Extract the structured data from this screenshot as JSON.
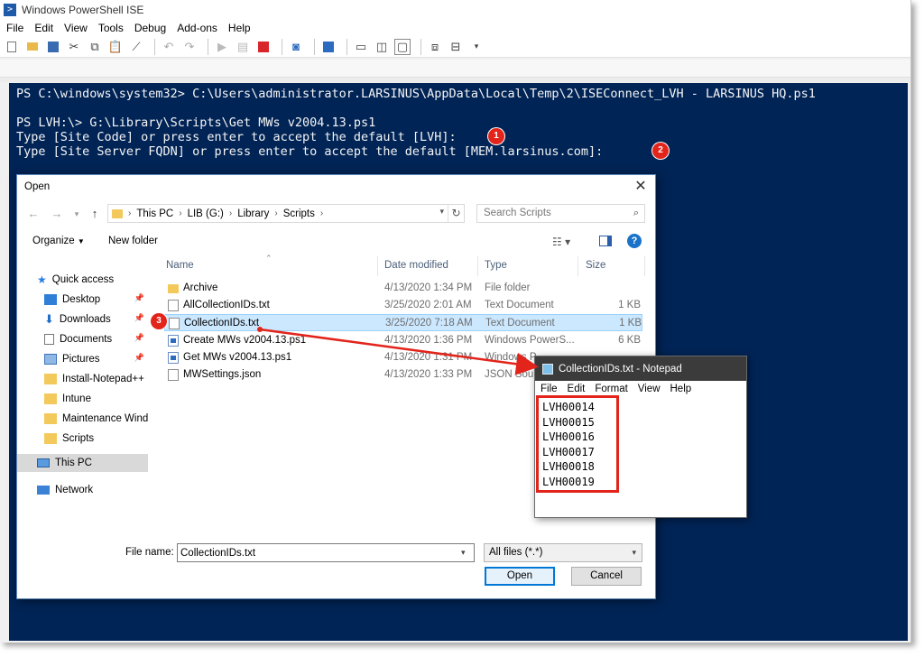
{
  "ise": {
    "title": "Windows PowerShell ISE",
    "menus": [
      "File",
      "Edit",
      "View",
      "Tools",
      "Debug",
      "Add-ons",
      "Help"
    ],
    "console_lines": [
      "PS C:\\windows\\system32> C:\\Users\\administrator.LARSINUS\\AppData\\Local\\Temp\\2\\ISEConnect_LVH - LARSINUS HQ.ps1",
      "",
      "PS LVH:\\> G:\\Library\\Scripts\\Get MWs v2004.13.ps1",
      "Type [Site Code] or press enter to accept the default [LVH]:",
      "Type [Site Server FQDN] or press enter to accept the default [MEM.larsinus.com]:"
    ]
  },
  "badges": [
    "1",
    "2",
    "3"
  ],
  "open_dialog": {
    "title": "Open",
    "address": [
      "This PC",
      "LIB (G:)",
      "Library",
      "Scripts"
    ],
    "search_placeholder": "Search Scripts",
    "organize": "Organize",
    "new_folder": "New folder",
    "nav": [
      {
        "label": "Quick access",
        "icon": "star-icon"
      },
      {
        "label": "Desktop",
        "icon": "desktop-icon",
        "pinned": true
      },
      {
        "label": "Downloads",
        "icon": "download-icon",
        "pinned": true
      },
      {
        "label": "Documents",
        "icon": "documents-icon",
        "pinned": true
      },
      {
        "label": "Pictures",
        "icon": "pictures-icon",
        "pinned": true
      },
      {
        "label": "Install-Notepad++",
        "icon": "folder-icon"
      },
      {
        "label": "Intune",
        "icon": "folder-icon"
      },
      {
        "label": "Maintenance Windo",
        "icon": "folder-icon"
      },
      {
        "label": "Scripts",
        "icon": "folder-icon"
      },
      {
        "label": "This PC",
        "icon": "pc-icon"
      },
      {
        "label": "Network",
        "icon": "network-icon"
      }
    ],
    "columns": [
      "Name",
      "Date modified",
      "Type",
      "Size"
    ],
    "files": [
      {
        "name": "Archive",
        "date": "4/13/2020 1:34 PM",
        "type": "File folder",
        "size": "",
        "kind": "folder"
      },
      {
        "name": "AllCollectionIDs.txt",
        "date": "3/25/2020 2:01 AM",
        "type": "Text Document",
        "size": "1 KB",
        "kind": "doc"
      },
      {
        "name": "CollectionIDs.txt",
        "date": "3/25/2020 7:18 AM",
        "type": "Text Document",
        "size": "1 KB",
        "kind": "doc"
      },
      {
        "name": "Create MWs v2004.13.ps1",
        "date": "4/13/2020 1:36 PM",
        "type": "Windows PowerS...",
        "size": "6 KB",
        "kind": "ps"
      },
      {
        "name": "Get MWs v2004.13.ps1",
        "date": "4/13/2020 1:31 PM",
        "type": "Windows P",
        "size": "",
        "kind": "ps"
      },
      {
        "name": "MWSettings.json",
        "date": "4/13/2020 1:33 PM",
        "type": "JSON Sourc",
        "size": "",
        "kind": "doc"
      }
    ],
    "file_name_label": "File name:",
    "file_name_value": "CollectionIDs.txt",
    "file_type": "All files (*.*)",
    "open_label": "Open",
    "cancel_label": "Cancel"
  },
  "notepad": {
    "title": "CollectionIDs.txt - Notepad",
    "menus": [
      "File",
      "Edit",
      "Format",
      "View",
      "Help"
    ],
    "lines": [
      "LVH00014",
      "LVH00015",
      "LVH00016",
      "LVH00017",
      "LVH00018",
      "LVH00019"
    ]
  },
  "colors": {
    "console_bg": "#012456",
    "badge": "#e2241b",
    "selection": "#cce8ff"
  }
}
